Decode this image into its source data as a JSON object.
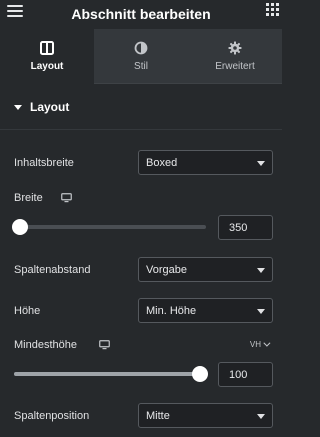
{
  "header": {
    "title": "Abschnitt bearbeiten",
    "menu_icon": "hamburger-icon",
    "apps_icon": "grid-icon"
  },
  "tabs": [
    {
      "label": "Layout",
      "icon": "columns-icon",
      "active": true
    },
    {
      "label": "Stil",
      "icon": "half-circle-icon",
      "active": false
    },
    {
      "label": "Erweitert",
      "icon": "gear-icon",
      "active": false
    }
  ],
  "section": {
    "title": "Layout"
  },
  "controls": {
    "inhaltsbreite": {
      "label": "Inhaltsbreite",
      "value": "Boxed"
    },
    "breite": {
      "label": "Breite",
      "value": "350",
      "slider_fraction": 0.0
    },
    "spaltenabstand": {
      "label": "Spaltenabstand",
      "value": "Vorgabe"
    },
    "hoehe": {
      "label": "Höhe",
      "value": "Min. Höhe"
    },
    "mindesthoehe": {
      "label": "Mindesthöhe",
      "value": "100",
      "unit": "VH",
      "slider_fraction": 1.0
    },
    "spaltenposition": {
      "label": "Spaltenposition",
      "value": "Mitte"
    }
  },
  "colors": {
    "background": "#26292c",
    "tab_bar": "#34383c",
    "input_bg": "#1f2124",
    "input_border": "#55595e"
  }
}
